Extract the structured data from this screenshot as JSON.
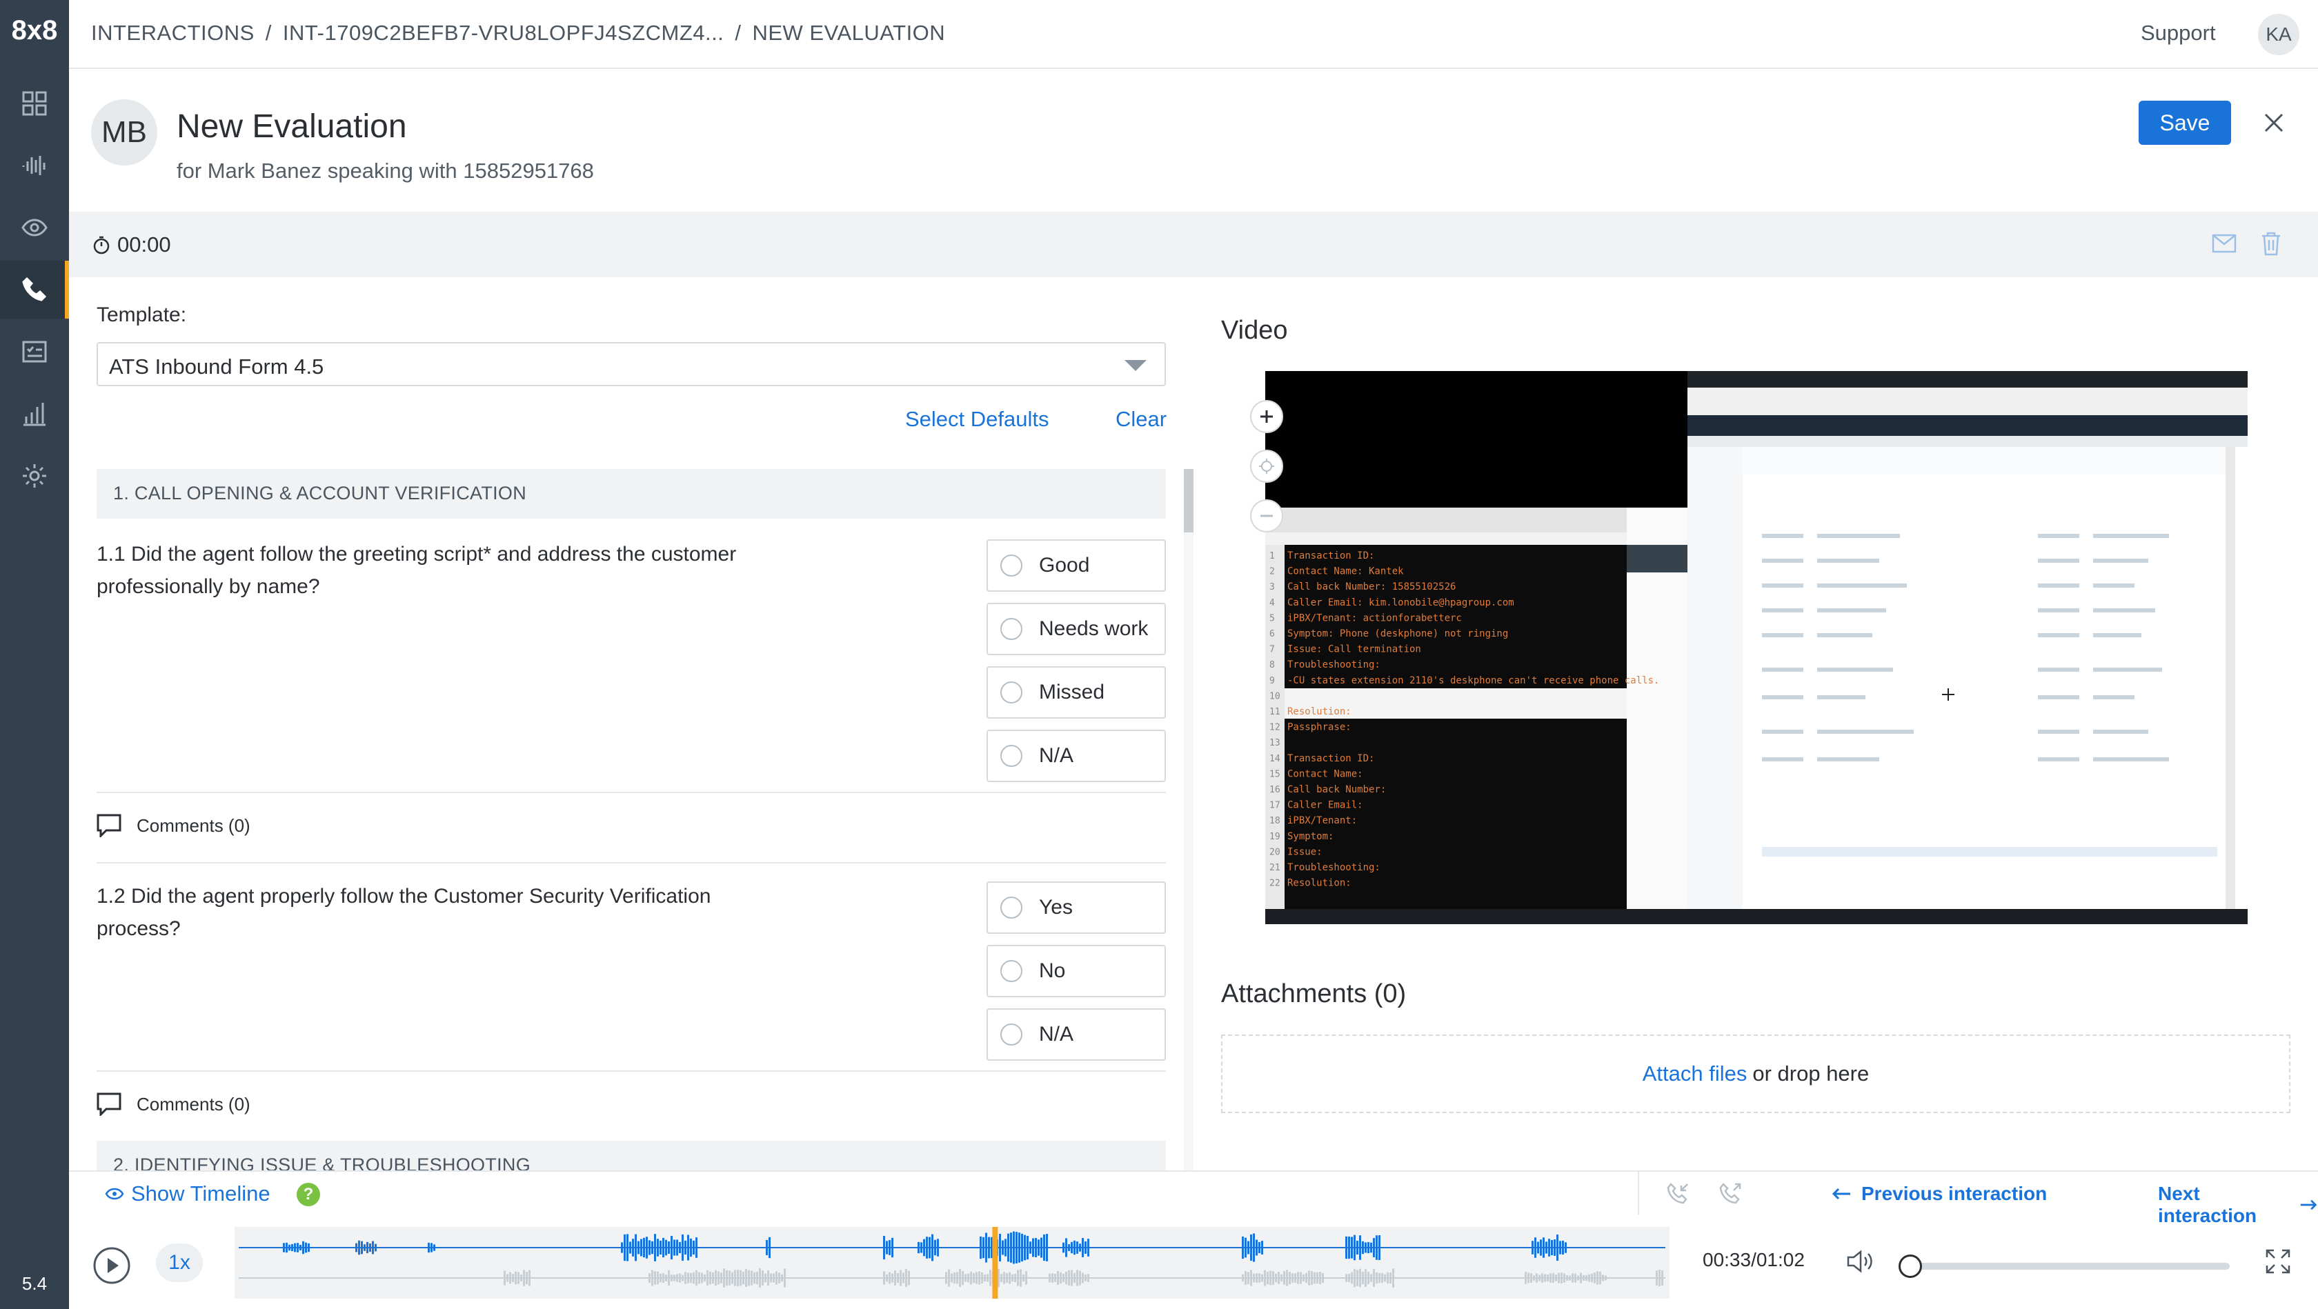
{
  "app": {
    "logo": "8x8",
    "version": "5.4"
  },
  "sidebar": {
    "items": [
      {
        "name": "dashboard",
        "icon": "grid-icon"
      },
      {
        "name": "speech",
        "icon": "waveform-icon"
      },
      {
        "name": "monitor",
        "icon": "eye-icon"
      },
      {
        "name": "interactions",
        "icon": "phone-icon",
        "active": true
      },
      {
        "name": "evaluations",
        "icon": "checklist-icon"
      },
      {
        "name": "reports",
        "icon": "bar-chart-icon"
      },
      {
        "name": "settings",
        "icon": "gear-icon"
      }
    ]
  },
  "header": {
    "breadcrumb": [
      "INTERACTIONS",
      "/",
      "INT-1709C2BEFB7-VRU8LOPFJ4SZCMZ4...",
      "/",
      "NEW EVALUATION"
    ],
    "support": "Support",
    "user_initials": "KA"
  },
  "evaluation": {
    "initials": "MB",
    "title": "New Evaluation",
    "subtitle": "for Mark Banez speaking with 15852951768",
    "save_label": "Save",
    "timer": "00:00"
  },
  "template": {
    "label": "Template:",
    "value": "ATS Inbound Form 4.5",
    "select_defaults": "Select Defaults",
    "clear": "Clear"
  },
  "sections": [
    {
      "title": "1. CALL OPENING & ACCOUNT VERIFICATION"
    },
    {
      "title": "2. IDENTIFYING ISSUE & TROUBLESHOOTING"
    }
  ],
  "questions": [
    {
      "text": "1.1 Did the agent follow the greeting script* and address the customer professionally by name?",
      "options": [
        "Good",
        "Needs work",
        "Missed",
        "N/A"
      ],
      "comments": "Comments (0)"
    },
    {
      "text": "1.2 Did the agent properly follow the Customer Security Verification process?",
      "options": [
        "Yes",
        "No",
        "N/A"
      ],
      "comments": "Comments (0)"
    }
  ],
  "video": {
    "title": "Video",
    "editor_lines": [
      "Transaction ID:",
      "Contact Name: Kantek",
      "Call back Number: 15855102526",
      "Caller Email: kim.lonobile@hpagroup.com",
      "iPBX/Tenant: actionforabetterc",
      "Symptom: Phone (deskphone) not ringing",
      "Issue: Call termination",
      "Troubleshooting:",
      "-CU states extension 2110's deskphone can't receive phone calls.",
      "",
      "Resolution:",
      "Passphrase:",
      "",
      "Transaction ID:",
      "Contact Name:",
      "Call back Number:",
      "Caller Email:",
      "iPBX/Tenant:",
      "Symptom:",
      "Issue:",
      "Troubleshooting:",
      "Resolution:"
    ]
  },
  "attachments": {
    "title": "Attachments (0)",
    "attach_link": "Attach files",
    "drop_text": "or drop here"
  },
  "player": {
    "show_timeline": "Show Timeline",
    "help": "?",
    "prev": "Previous interaction",
    "next": "Next interaction",
    "speed": "1x",
    "time": "00:33/01:02",
    "progress": 0.53,
    "volume": 0.0
  },
  "colors": {
    "sidebar": "#33414e",
    "accent": "#1a73d9",
    "active_marker": "#f5a623",
    "waveform": "#1a73d9",
    "playhead": "#f5a623"
  }
}
